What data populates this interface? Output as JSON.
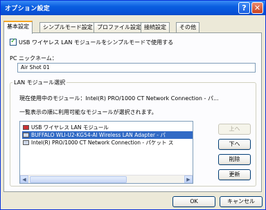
{
  "window": {
    "title": "オプション設定",
    "help_label": "?",
    "close_label": "✕"
  },
  "tabs": [
    {
      "label": "基本設定"
    },
    {
      "label": "シンプルモード設定"
    },
    {
      "label": "プロファイル設定"
    },
    {
      "label": "接続設定"
    },
    {
      "label": "その他"
    }
  ],
  "simple_mode": {
    "label": "USB ワイヤレス LAN モジュールをシンプルモードで使用する",
    "checked": true
  },
  "pc_nickname": {
    "label": "PC ニックネーム：",
    "value": "Air Shot 01"
  },
  "lan_module": {
    "group_label": "LAN モジュール選択",
    "current_text": "現在使用中のモジュール：Intel(R) PRO/1000 CT Network Connection - パ...",
    "info_text": "一覧表示の順に利用可能なモジュールが選択されます。",
    "items": [
      {
        "label": "USB ワイヤレス LAN モジュール",
        "icon": "network-adapter-icon"
      },
      {
        "label": "BUFFALO WLI-U2-KG54-AI Wireless LAN Adapter - パ",
        "icon": "network-adapter-icon",
        "selected": true
      },
      {
        "label": "Intel(R) PRO/1000 CT Network Connection - パケット ス",
        "icon": "network-adapter-icon"
      }
    ],
    "buttons": {
      "up": "上へ",
      "down": "下へ",
      "delete": "削除",
      "update": "更新"
    }
  },
  "footer": {
    "ok": "OK",
    "cancel": "キャンセル"
  },
  "colors": {
    "titlebar": "#0a5ee0",
    "selection": "#316ac5",
    "tab_highlight": "#f5a623"
  }
}
